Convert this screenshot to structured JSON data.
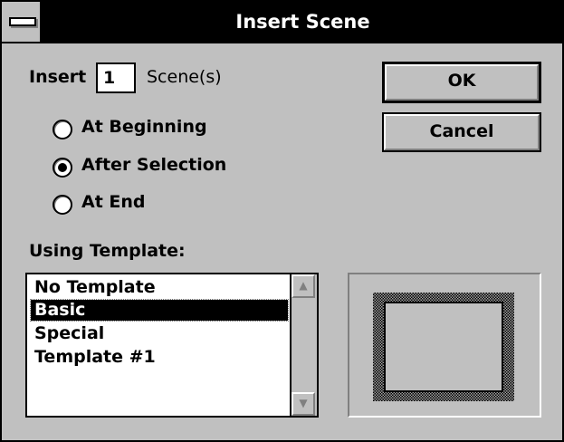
{
  "window": {
    "title": "Insert Scene"
  },
  "insert": {
    "prefix": "Insert",
    "count": "1",
    "suffix": "Scene(s)"
  },
  "position": {
    "options": [
      "At Beginning",
      "After Selection",
      "At End"
    ],
    "selected": "After Selection"
  },
  "template": {
    "label": "Using Template:",
    "items": [
      "No Template",
      "Basic",
      "Special",
      "Template #1"
    ],
    "selected": "Basic"
  },
  "buttons": {
    "ok": "OK",
    "cancel": "Cancel"
  },
  "icons": {
    "system_menu": "system-menu-icon",
    "scroll_up": "scroll-up-arrow-icon",
    "scroll_down": "scroll-down-arrow-icon"
  }
}
